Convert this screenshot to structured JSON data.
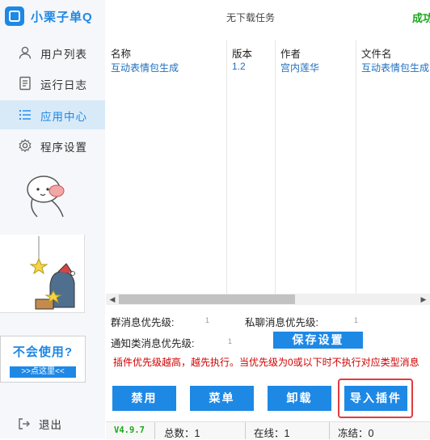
{
  "app": {
    "title": "小栗子单Q"
  },
  "header": {
    "task_status": "无下载任务",
    "right_text": "成功"
  },
  "sidebar": {
    "items": [
      {
        "label": "用户列表",
        "icon": "user-icon"
      },
      {
        "label": "运行日志",
        "icon": "log-icon"
      },
      {
        "label": "应用中心",
        "icon": "list-icon",
        "active": true
      },
      {
        "label": "程序设置",
        "icon": "gear-icon"
      }
    ],
    "help_title": "不会使用?",
    "help_button": ">>点这里<<",
    "exit_label": "退出"
  },
  "table": {
    "columns": [
      "名称",
      "版本",
      "作者",
      "文件名"
    ],
    "rows": [
      [
        "互动表情包生成",
        "1.2",
        "宫内莲华",
        "互动表情包生成"
      ]
    ]
  },
  "settings": {
    "group_priority_label": "群消息优先级:",
    "group_priority_value": "1",
    "private_priority_label": "私聊消息优先级:",
    "private_priority_value": "1",
    "notify_priority_label": "通知类消息优先级:",
    "notify_priority_value": "1",
    "save_label": "保存设置",
    "warning": "插件优先级越高，越先执行。当优先级为0或以下时不执行对应类型消息"
  },
  "actions": {
    "disable": "禁用",
    "menu": "菜单",
    "uninstall": "卸载",
    "import": "导入插件"
  },
  "statusbar": {
    "version": "V4.9.7",
    "total": "总数：1",
    "online": "在线：1",
    "frozen": "冻结：0"
  },
  "colors": {
    "accent": "#1e88e5",
    "success": "#1aa91a",
    "warning": "#d10000",
    "highlight": "#e23c3c"
  }
}
